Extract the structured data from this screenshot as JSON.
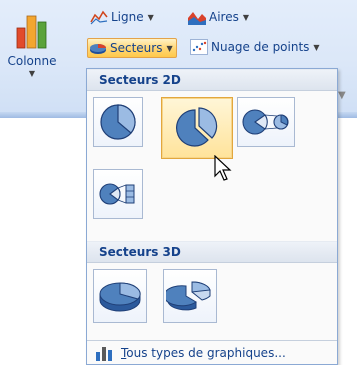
{
  "ribbon": {
    "colonne_label": "Colonne",
    "ligne_label": "Ligne",
    "aires_label": "Aires",
    "secteurs_label": "Secteurs",
    "nuage_label": "Nuage de points"
  },
  "dropdown": {
    "section_2d": "Secteurs 2D",
    "section_3d": "Secteurs 3D",
    "footer_first_letter": "T",
    "footer_rest": "ous types de graphiques..."
  },
  "icons": {
    "pie": "pie-chart-icon",
    "exploded_pie": "exploded-pie-icon",
    "pie_of_pie": "pie-of-pie-icon",
    "bar_of_pie": "bar-of-pie-icon",
    "pie_3d": "pie-3d-icon",
    "exploded_pie_3d": "exploded-pie-3d-icon",
    "all_charts": "all-charts-icon"
  },
  "colors": {
    "accent": "#15428b",
    "pie_blue": "#4f81bd",
    "hover_orange": "#ffd778"
  }
}
